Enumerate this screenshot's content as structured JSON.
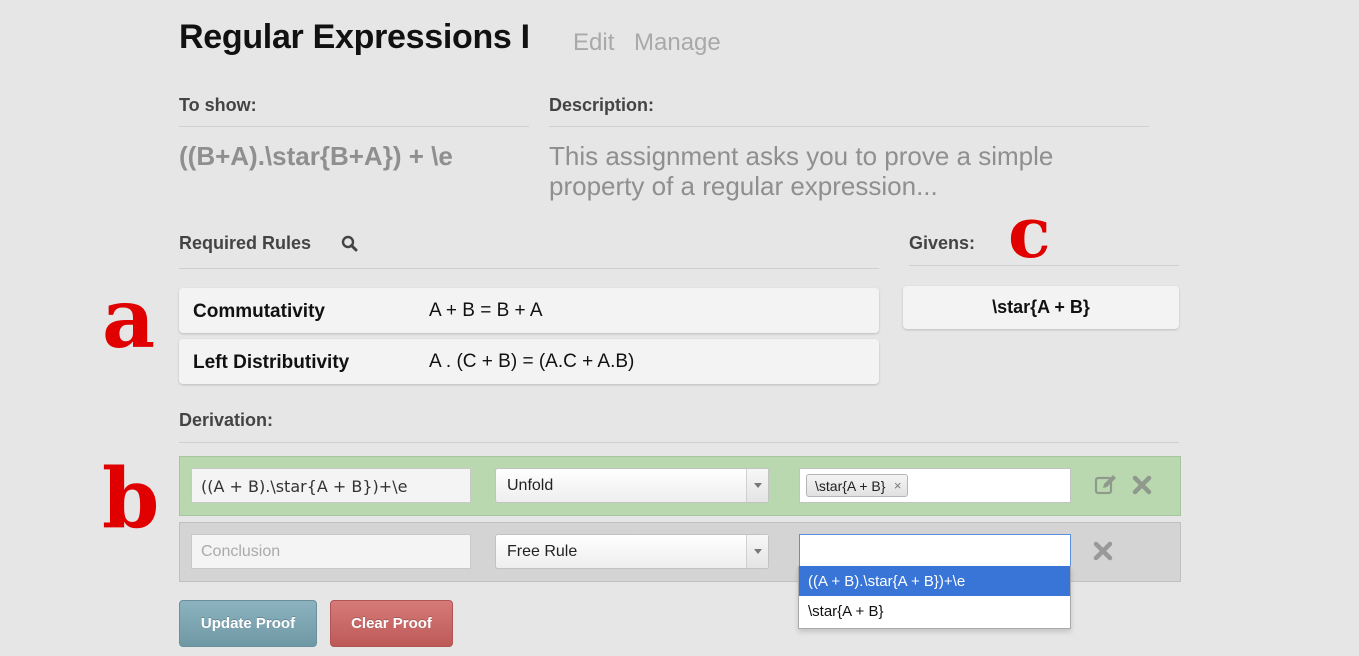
{
  "header": {
    "title": "Regular Expressions I",
    "edit_label": "Edit",
    "manage_label": "Manage"
  },
  "to_show": {
    "label": "To show:",
    "expression": "((B+A).\\star{B+A}) + \\e"
  },
  "description": {
    "label": "Description:",
    "text": "This assignment asks you to prove a simple property of a regular expression..."
  },
  "required_rules": {
    "label": "Required Rules",
    "icon": "search-icon",
    "items": [
      {
        "name": "Commutativity",
        "formula": "A + B = B + A"
      },
      {
        "name": "Left Distributivity",
        "formula": "A . (C + B) = (A.C + A.B)"
      }
    ]
  },
  "givens": {
    "label": "Givens:",
    "items": [
      "\\star{A + B}"
    ]
  },
  "derivation": {
    "label": "Derivation:",
    "rows": [
      {
        "expression": "((A + B).\\star{A + B})+\\e",
        "rule": "Unfold",
        "chips": [
          "\\star{A + B}"
        ],
        "chip_remove": "×",
        "status_color": "#b9d8b0"
      },
      {
        "placeholder": "Conclusion",
        "rule": "Free Rule",
        "search_value": ""
      }
    ],
    "dropdown_options": [
      "((A + B).\\star{A + B})+\\e",
      "\\star{A + B}"
    ],
    "dropdown_selected": 0
  },
  "buttons": {
    "update": "Update Proof",
    "clear": "Clear Proof"
  },
  "annotations": {
    "a": "a",
    "b": "b",
    "c": "c",
    "color": "#e00000"
  }
}
